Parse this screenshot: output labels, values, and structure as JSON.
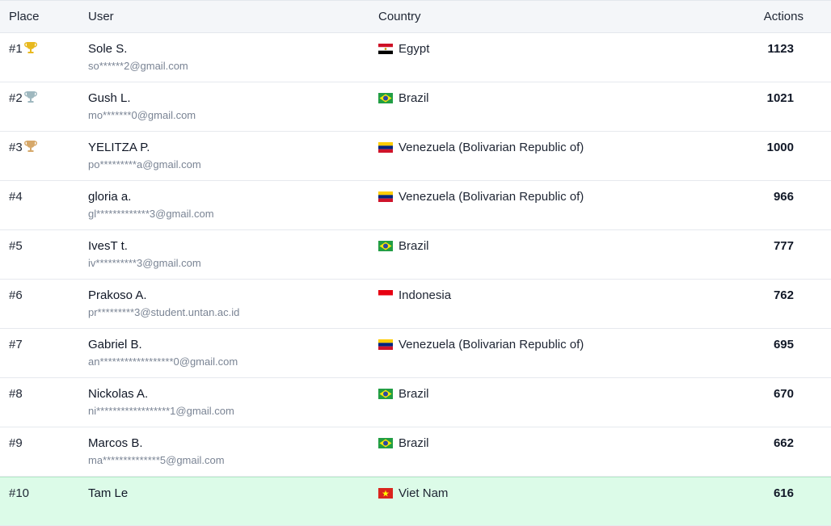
{
  "headers": {
    "place": "Place",
    "user": "User",
    "country": "Country",
    "actions": "Actions"
  },
  "rows": [
    {
      "place": "#1",
      "trophy": "gold",
      "name": "Sole S.",
      "email": "so******2@gmail.com",
      "country": "Egypt",
      "flag": "egypt",
      "actions": "1123"
    },
    {
      "place": "#2",
      "trophy": "silver",
      "name": "Gush L.",
      "email": "mo*******0@gmail.com",
      "country": "Brazil",
      "flag": "brazil",
      "actions": "1021"
    },
    {
      "place": "#3",
      "trophy": "bronze",
      "name": "YELITZA P.",
      "email": "po*********a@gmail.com",
      "country": "Venezuela (Bolivarian Republic of)",
      "flag": "venezuela",
      "actions": "1000"
    },
    {
      "place": "#4",
      "trophy": "",
      "name": "gloria a.",
      "email": "gl*************3@gmail.com",
      "country": "Venezuela (Bolivarian Republic of)",
      "flag": "venezuela",
      "actions": "966"
    },
    {
      "place": "#5",
      "trophy": "",
      "name": "IvesT t.",
      "email": "iv**********3@gmail.com",
      "country": "Brazil",
      "flag": "brazil",
      "actions": "777"
    },
    {
      "place": "#6",
      "trophy": "",
      "name": "Prakoso A.",
      "email": "pr*********3@student.untan.ac.id",
      "country": "Indonesia",
      "flag": "indonesia",
      "actions": "762"
    },
    {
      "place": "#7",
      "trophy": "",
      "name": "Gabriel B.",
      "email": "an******************0@gmail.com",
      "country": "Venezuela (Bolivarian Republic of)",
      "flag": "venezuela",
      "actions": "695"
    },
    {
      "place": "#8",
      "trophy": "",
      "name": "Nickolas A.",
      "email": "ni******************1@gmail.com",
      "country": "Brazil",
      "flag": "brazil",
      "actions": "670"
    },
    {
      "place": "#9",
      "trophy": "",
      "name": "Marcos B.",
      "email": "ma**************5@gmail.com",
      "country": "Brazil",
      "flag": "brazil",
      "actions": "662"
    },
    {
      "place": "#10",
      "trophy": "",
      "name": "Tam Le",
      "email": "",
      "country": "Viet Nam",
      "flag": "vietnam",
      "actions": "616",
      "highlight": true
    }
  ],
  "colors": {
    "gold": "#e8b91f",
    "silver": "#9fb8bf",
    "bronze": "#d6a86a",
    "highlight": "#dcfbe8"
  }
}
